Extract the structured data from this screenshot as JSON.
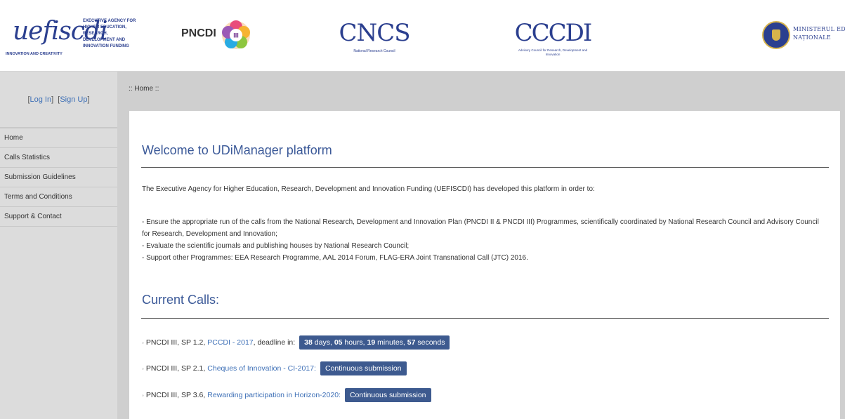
{
  "header": {
    "uefiscdi": {
      "wordmark": "uefiscdi",
      "agency": "EXECUTIVE AGENCY FOR HIGHER EDUCATION, RESEARCH, DEVELOPMENT AND INNOVATION FUNDING",
      "tagline": "INNOVATION AND CREATIVITY"
    },
    "pncdi": {
      "wordmark": "PNCDI",
      "numeral": "III"
    },
    "cncs": {
      "wordmark": "CNCS",
      "subtitle": "National Research Council"
    },
    "cccdi": {
      "wordmark": "CCCDI",
      "subtitle": "Advisory Council for Research, Development and Innovation"
    },
    "ministry": {
      "line1": "MINISTERUL EDUCAȚIEI",
      "line2": "NAȚIONALE"
    }
  },
  "sidebar": {
    "login": "Log In",
    "signup": "Sign Up",
    "items": [
      {
        "label": "Home"
      },
      {
        "label": "Calls Statistics"
      },
      {
        "label": "Submission Guidelines"
      },
      {
        "label": "Terms and Conditions"
      },
      {
        "label": "Support & Contact"
      }
    ]
  },
  "breadcrumb": ":: Home ::",
  "main": {
    "title": "Welcome to UDiManager platform",
    "intro": "The Executive Agency for Higher Education, Research, Development and Innovation Funding (UEFISCDI) has developed this platform in order to:",
    "bullets": [
      "- Ensure the appropriate run of the calls from the National Research, Development and Innovation Plan (PNCDI II & PNCDI III) Programmes, scientifically coordinated by National Research Council and Advisory Council for Research, Development and Innovation;",
      "- Evaluate the scientific journals and publishing houses by National Research Council;",
      "- Support other Programmes: EEA Research Programme, AAL 2014 Forum, FLAG-ERA Joint Transnational Call (JTC) 2016."
    ],
    "calls_title": "Current Calls:",
    "calls": [
      {
        "prefix": "PNCDI III, SP 1.2,",
        "link": "PCCDI - 2017",
        "suffix": ", deadline in:",
        "countdown": {
          "days": "38",
          "days_label": "days,",
          "hours": "05",
          "hours_label": "hours,",
          "minutes": "19",
          "minutes_label": "minutes,",
          "seconds": "57",
          "seconds_label": "seconds"
        }
      },
      {
        "prefix": "PNCDI III, SP 2.1,",
        "link": "Cheques of Innovation - CI-2017:",
        "badge": "Continuous submission"
      },
      {
        "prefix": "PNCDI III, SP 3.6,",
        "link": "Rewarding participation in Horizon-2020:",
        "badge": "Continuous submission"
      }
    ]
  },
  "colors": {
    "accent": "#3b5998",
    "link": "#3d6fb6",
    "badge": "#3d5a8f",
    "sidebar": "#dcdcdc",
    "page_bg": "#cfcfcf"
  }
}
